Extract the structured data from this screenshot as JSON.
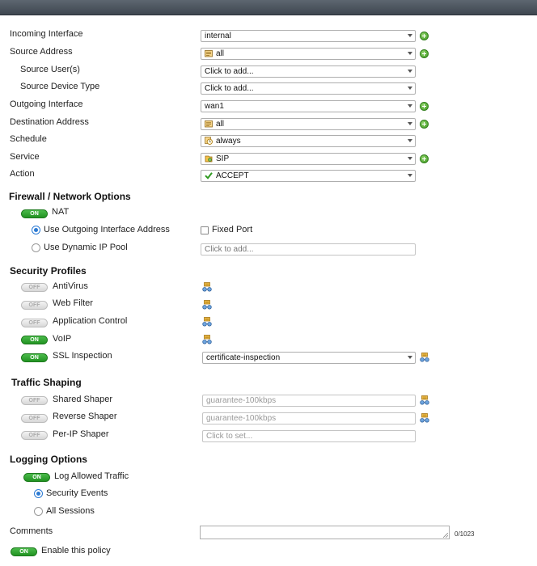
{
  "policy": {
    "incoming_interface": {
      "label": "Incoming Interface",
      "value": "internal"
    },
    "source_address": {
      "label": "Source Address",
      "value": "all"
    },
    "source_users": {
      "label": "Source User(s)",
      "value": "Click to add..."
    },
    "source_device_type": {
      "label": "Source Device Type",
      "value": "Click to add..."
    },
    "outgoing_interface": {
      "label": "Outgoing Interface",
      "value": "wan1"
    },
    "destination_address": {
      "label": "Destination Address",
      "value": "all"
    },
    "schedule": {
      "label": "Schedule",
      "value": "always"
    },
    "service": {
      "label": "Service",
      "value": "SIP"
    },
    "action": {
      "label": "Action",
      "value": "ACCEPT"
    }
  },
  "firewall": {
    "title": "Firewall / Network Options",
    "nat": {
      "label": "NAT",
      "toggle": "ON"
    },
    "use_outgoing": {
      "label": "Use Outgoing Interface Address",
      "checked": true
    },
    "fixed_port": {
      "label": "Fixed Port",
      "checked": false
    },
    "use_dynamic": {
      "label": "Use Dynamic IP Pool",
      "checked": false
    },
    "ip_pool_placeholder": "Click to add..."
  },
  "security": {
    "title": "Security Profiles",
    "antivirus": {
      "label": "AntiVirus",
      "toggle": "OFF"
    },
    "webfilter": {
      "label": "Web Filter",
      "toggle": "OFF"
    },
    "appcontrol": {
      "label": "Application Control",
      "toggle": "OFF"
    },
    "voip": {
      "label": "VoIP",
      "toggle": "ON"
    },
    "ssl": {
      "label": "SSL Inspection",
      "toggle": "ON",
      "value": "certificate-inspection"
    }
  },
  "shaping": {
    "title": "Traffic Shaping",
    "shared": {
      "label": "Shared Shaper",
      "toggle": "OFF",
      "placeholder": "guarantee-100kbps"
    },
    "reverse": {
      "label": "Reverse Shaper",
      "toggle": "OFF",
      "placeholder": "guarantee-100kbps"
    },
    "perip": {
      "label": "Per-IP Shaper",
      "toggle": "OFF",
      "placeholder": "Click to set..."
    }
  },
  "logging": {
    "title": "Logging Options",
    "log_allowed": {
      "label": "Log Allowed Traffic",
      "toggle": "ON"
    },
    "security_events": {
      "label": "Security Events",
      "checked": true
    },
    "all_sessions": {
      "label": "All Sessions",
      "checked": false
    }
  },
  "comments": {
    "label": "Comments",
    "counter": "0/1023",
    "value": ""
  },
  "enable": {
    "label": "Enable this policy",
    "toggle": "ON"
  },
  "colors": {
    "toggle_on": "#2a9c2a",
    "radio_selected": "#2b7ad3",
    "add_button": "#4aa52a",
    "titlebar": "#4a525c"
  },
  "icons": {
    "add": "plus-circle-icon",
    "address": "address-object-icon",
    "schedule": "clock-icon",
    "service": "service-icon",
    "accept": "checkmark-icon",
    "profile": "profile-edit-icon",
    "dropdown": "chevron-down-icon"
  }
}
